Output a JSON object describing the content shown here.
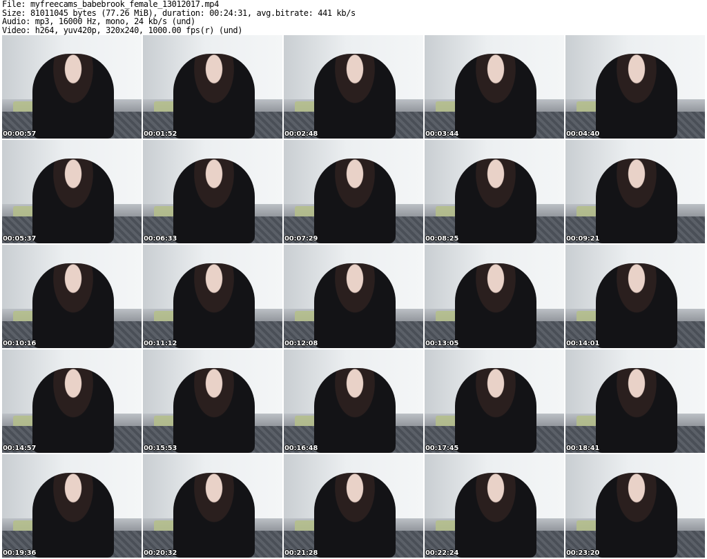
{
  "header": {
    "file": "File: myfreecams_babebrook_female_13012017.mp4",
    "size": "Size: 81011045 bytes (77.26 MiB), duration: 00:24:31, avg.bitrate: 441 kb/s",
    "audio": "Audio: mp3, 16000 Hz, mono, 24 kb/s (und)",
    "video": "Video: h264, yuv420p, 320x240, 1000.00 fps(r) (und)"
  },
  "thumbnails": [
    {
      "time": "00:00:57"
    },
    {
      "time": "00:01:52"
    },
    {
      "time": "00:02:48"
    },
    {
      "time": "00:03:44"
    },
    {
      "time": "00:04:40"
    },
    {
      "time": "00:05:37"
    },
    {
      "time": "00:06:33"
    },
    {
      "time": "00:07:29"
    },
    {
      "time": "00:08:25"
    },
    {
      "time": "00:09:21"
    },
    {
      "time": "00:10:16"
    },
    {
      "time": "00:11:12"
    },
    {
      "time": "00:12:08"
    },
    {
      "time": "00:13:05"
    },
    {
      "time": "00:14:01"
    },
    {
      "time": "00:14:57"
    },
    {
      "time": "00:15:53"
    },
    {
      "time": "00:16:48"
    },
    {
      "time": "00:17:45"
    },
    {
      "time": "00:18:41"
    },
    {
      "time": "00:19:36"
    },
    {
      "time": "00:20:32"
    },
    {
      "time": "00:21:28"
    },
    {
      "time": "00:22:24"
    },
    {
      "time": "00:23:20"
    }
  ]
}
